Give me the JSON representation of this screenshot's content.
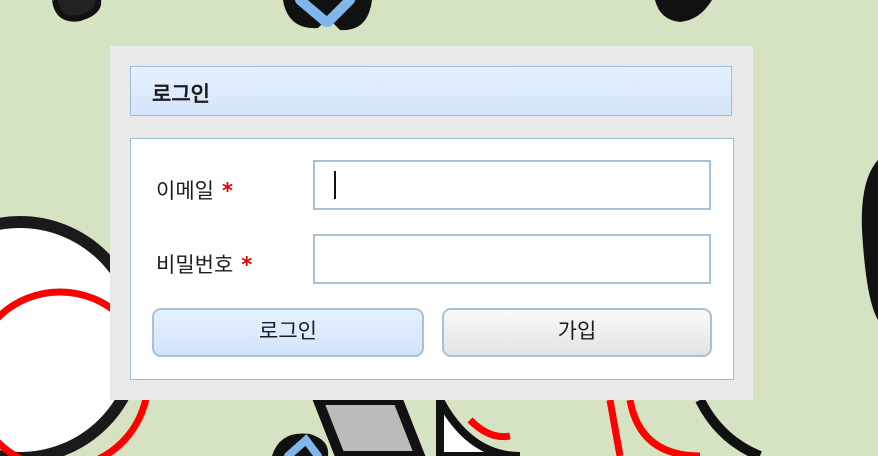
{
  "dialog": {
    "title": "로그인",
    "fields": {
      "email": {
        "label": "이메일",
        "required_marker": "*",
        "value": ""
      },
      "password": {
        "label": "비밀번호",
        "required_marker": "*",
        "value": ""
      }
    },
    "buttons": {
      "login": "로그인",
      "signup": "가입"
    }
  },
  "colors": {
    "background": "#d6e3c3",
    "title_bar": "#dbeafd",
    "border": "#9dbdd4",
    "required": "#e00000"
  }
}
